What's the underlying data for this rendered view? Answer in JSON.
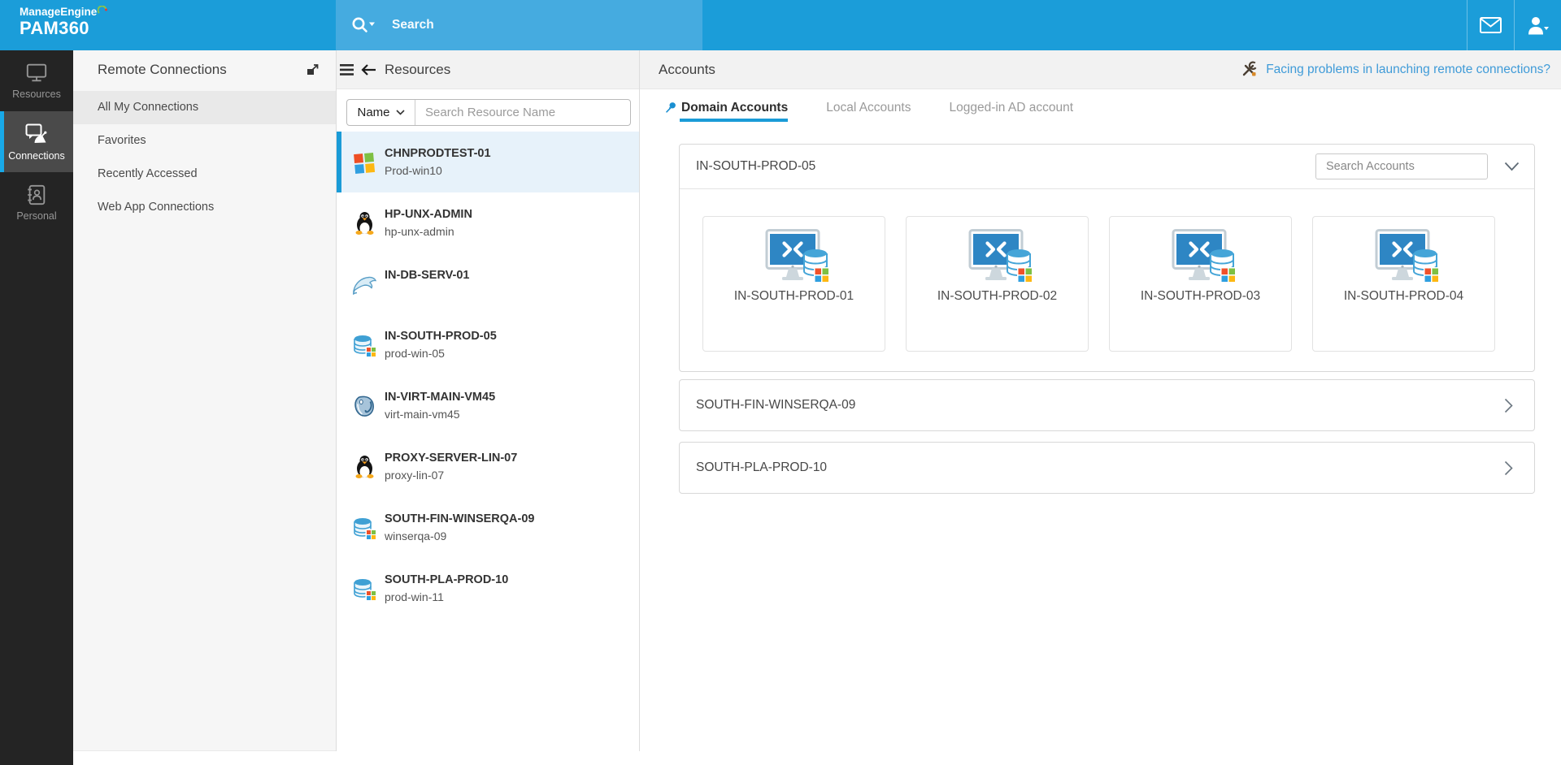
{
  "colors": {
    "brand-bar": "#1b9dd9",
    "search-seg": "#45abe0",
    "accent": "#1a9bd7",
    "sidebar-bg": "#242424",
    "sidebar-active": "#4a4a4a",
    "link": "#3f9bd8"
  },
  "header": {
    "brand_top": "ManageEngine",
    "brand_bottom": "PAM360",
    "search_placeholder": "Search"
  },
  "sidebar": {
    "items": [
      {
        "id": "resources",
        "label": "Resources",
        "icon": "monitor"
      },
      {
        "id": "connections",
        "label": "Connections",
        "icon": "connections",
        "active": true
      },
      {
        "id": "personal",
        "label": "Personal",
        "icon": "personal"
      }
    ]
  },
  "connections_panel": {
    "title": "Remote Connections",
    "items": [
      {
        "id": "all-my-connections",
        "label": "All My Connections",
        "selected": true
      },
      {
        "id": "favorites",
        "label": "Favorites"
      },
      {
        "id": "recently-accessed",
        "label": "Recently Accessed"
      },
      {
        "id": "web-app-connections",
        "label": "Web App Connections"
      }
    ]
  },
  "resources_panel": {
    "title": "Resources",
    "filter_label": "Name",
    "search_placeholder": "Search Resource Name",
    "items": [
      {
        "name": "CHNPRODTEST-01",
        "sub": "Prod-win10",
        "icon": "windows",
        "selected": true
      },
      {
        "name": "HP-UNX-ADMIN",
        "sub": "hp-unx-admin",
        "icon": "tux"
      },
      {
        "name": "IN-DB-SERV-01",
        "sub": "",
        "icon": "mysql"
      },
      {
        "name": "IN-SOUTH-PROD-05",
        "sub": "prod-win-05",
        "icon": "db-windows"
      },
      {
        "name": "IN-VIRT-MAIN-VM45",
        "sub": "virt-main-vm45",
        "icon": "postgres"
      },
      {
        "name": "PROXY-SERVER-LIN-07",
        "sub": "proxy-lin-07",
        "icon": "tux"
      },
      {
        "name": "SOUTH-FIN-WINSERQA-09",
        "sub": "winserqa-09",
        "icon": "db-windows"
      },
      {
        "name": "SOUTH-PLA-PROD-10",
        "sub": "prod-win-11",
        "icon": "db-windows"
      }
    ]
  },
  "accounts_panel": {
    "title": "Accounts",
    "help_link": "Facing problems in launching remote connections?",
    "tabs": [
      {
        "id": "domain-accounts",
        "label": "Domain Accounts",
        "active": true,
        "pinned": true
      },
      {
        "id": "local-accounts",
        "label": "Local Accounts"
      },
      {
        "id": "logged-in-ad-account",
        "label": "Logged-in AD account"
      }
    ],
    "expanded_group": {
      "name": "IN-SOUTH-PROD-05",
      "search_placeholder": "Search Accounts",
      "accounts": [
        {
          "name": "IN-SOUTH-PROD-01",
          "icon": "rdp-windows"
        },
        {
          "name": "IN-SOUTH-PROD-02",
          "icon": "rdp-windows"
        },
        {
          "name": "IN-SOUTH-PROD-03",
          "icon": "rdp-windows"
        },
        {
          "name": "IN-SOUTH-PROD-04",
          "icon": "rdp-windows"
        }
      ]
    },
    "collapsed_groups": [
      {
        "name": "SOUTH-FIN-WINSERQA-09"
      },
      {
        "name": "SOUTH-PLA-PROD-10"
      }
    ]
  }
}
